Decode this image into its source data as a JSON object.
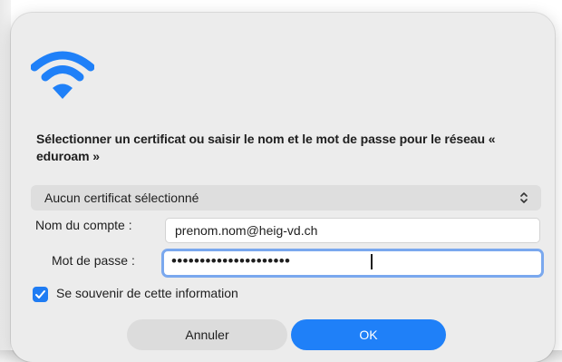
{
  "dialog": {
    "message": "Sélectionner un certificat ou saisir le nom et le mot de passe pour le réseau « eduroam »",
    "icon": "wifi-icon",
    "accent_color": "#1f80f8"
  },
  "certificate": {
    "selected": "Aucun certificat sélectionné",
    "icon": "chevron-up-down-icon"
  },
  "account": {
    "label": "Nom du compte :",
    "value": "prenom.nom@heig-vd.ch"
  },
  "password": {
    "label": "Mot de passe :",
    "masked_value": "•••••••••••••••••••••"
  },
  "remember": {
    "label": "Se souvenir de cette information",
    "checked": true
  },
  "buttons": {
    "cancel": "Annuler",
    "ok": "OK"
  }
}
